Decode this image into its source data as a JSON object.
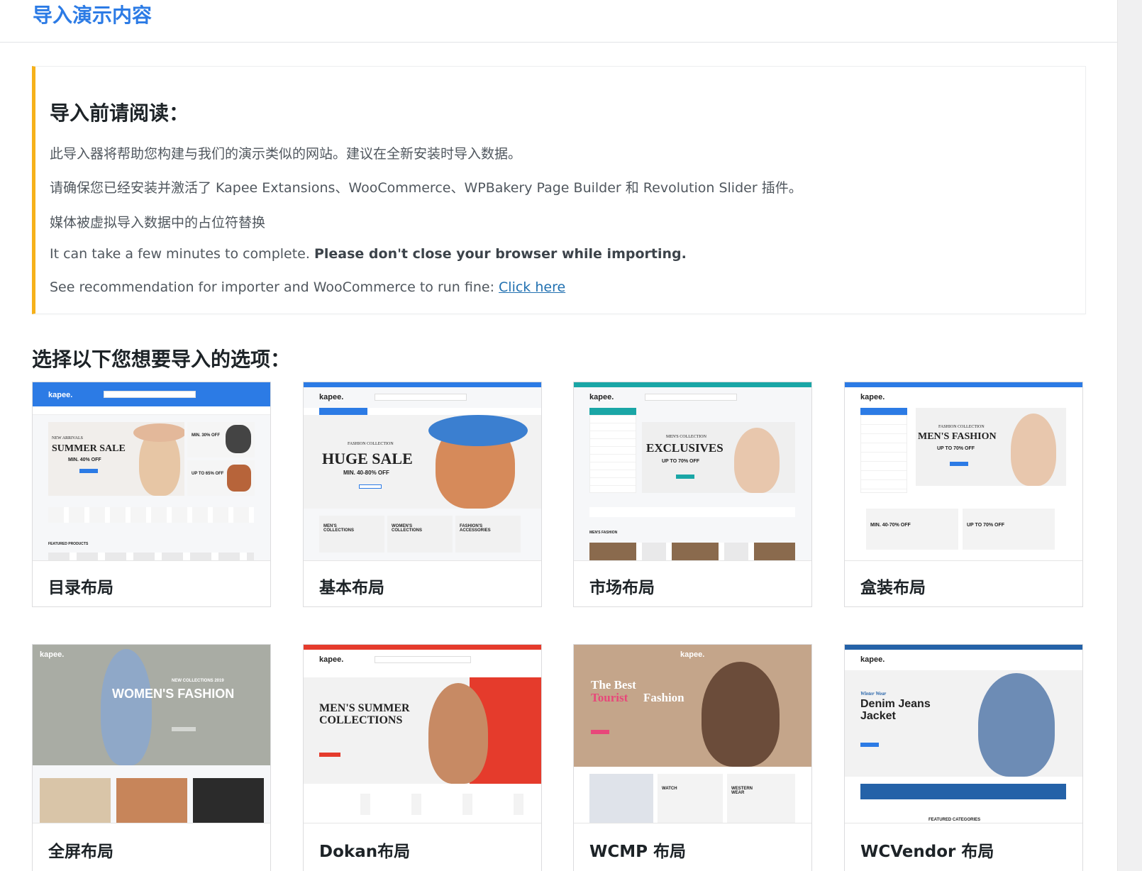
{
  "page_title": "导入演示内容",
  "notice": {
    "heading": "导入前请阅读：",
    "line1": "此导入器将帮助您构建与我们的演示类似的网站。建议在全新安装时导入数据。",
    "line2": "请确保您已经安装并激活了 Kapee Extansions、WooCommerce、WPBakery Page Builder 和 Revolution Slider 插件。",
    "line3": "媒体被虚拟导入数据中的占位符替换",
    "line4_plain": "It can take a few minutes to complete. ",
    "line4_bold": "Please don't close your browser while importing.",
    "line5_plain": "See recommendation for importer and WooCommerce to run fine: ",
    "line5_link": "Click here"
  },
  "section_title": "选择以下您想要导入的选项：",
  "colors": {
    "title_blue": "#2c7be5",
    "notice_border": "#f6b11a",
    "link": "#2271b1"
  },
  "demos": [
    {
      "label": "目录布局",
      "preview": {
        "brand": "kapee.",
        "headline": "SUMMER SALE",
        "pre": "NEW ARRIVALS",
        "sub": "MIN. 40% OFF",
        "side1": "MIN. 30% OFF",
        "side2": "UP TO 65% OFF",
        "section": "FEATURED PRODUCTS"
      }
    },
    {
      "label": "基本布局",
      "preview": {
        "brand": "kapee.",
        "pre": "FASHION COLLECTION",
        "headline": "HUGE SALE",
        "sub": "MIN. 40-80% OFF",
        "tile1": "MEN'S COLLECTIONS",
        "tile2": "WOMEN'S COLLECTIONS",
        "tile3": "FASHION'S ACCESSORIES"
      }
    },
    {
      "label": "市场布局",
      "preview": {
        "brand": "kapee.",
        "pre": "MEN'S COLLECTION",
        "headline": "EXCLUSIVES",
        "sub": "UP TO 70% OFF",
        "section": "MEN'S FASHION"
      }
    },
    {
      "label": "盒装布局",
      "preview": {
        "brand": "kapee.",
        "pre": "FASHION COLLECTION",
        "headline": "MEN'S FASHION",
        "sub": "UP TO 70% OFF",
        "tile1": "MIN. 40-70% OFF",
        "tile2": "UP TO 70% OFF"
      }
    },
    {
      "label": "全屏布局",
      "preview": {
        "brand": "kapee.",
        "pre": "NEW COLLECTIONS 2019",
        "headline": "WOMEN'S FASHION"
      }
    },
    {
      "label": "Dokan布局",
      "preview": {
        "brand": "kapee.",
        "headline": "MEN'S SUMMER COLLECTIONS"
      }
    },
    {
      "label": "WCMP 布局",
      "preview": {
        "brand": "kapee.",
        "headline1": "The Best",
        "headline2a": "Tourist",
        "headline2b": "Fashion",
        "tile1": "WATCH",
        "tile2": "WESTERN WEAR"
      }
    },
    {
      "label": "WCVendor 布局",
      "preview": {
        "brand": "kapee.",
        "pre": "Winter Wear",
        "headline": "Denim Jeans Jacket",
        "section": "FEATURED CATEGORIES"
      }
    }
  ]
}
